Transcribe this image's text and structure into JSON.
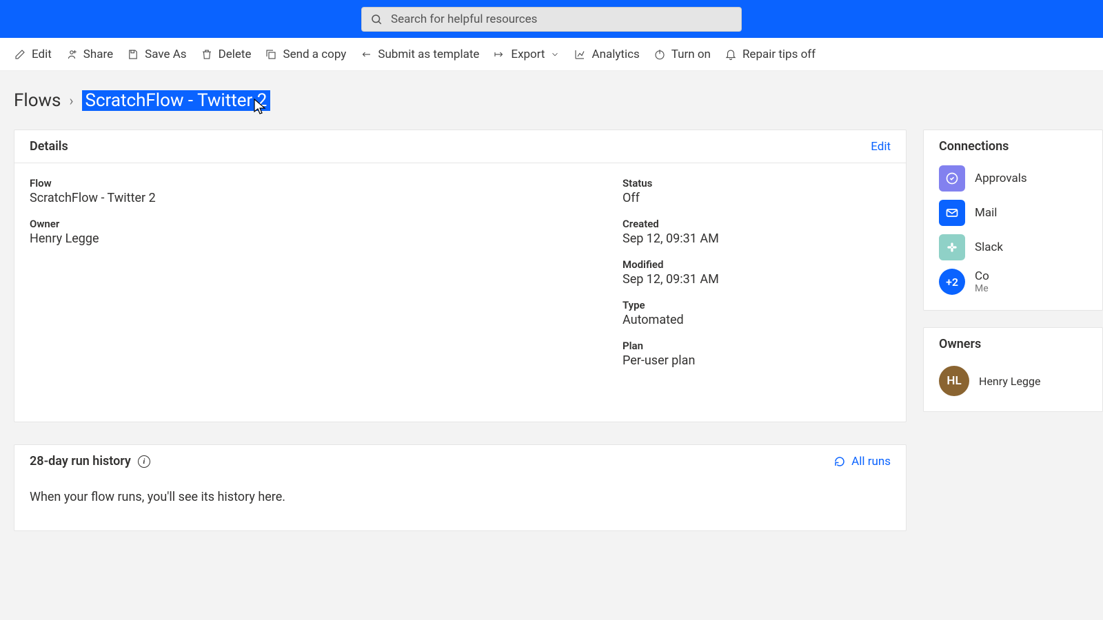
{
  "search": {
    "placeholder": "Search for helpful resources"
  },
  "toolbar": {
    "edit": "Edit",
    "share": "Share",
    "saveas": "Save As",
    "delete": "Delete",
    "sendcopy": "Send a copy",
    "submit": "Submit as template",
    "export": "Export",
    "analytics": "Analytics",
    "turnon": "Turn on",
    "repair": "Repair tips off"
  },
  "breadcrumb": {
    "root": "Flows",
    "current": "ScratchFlow - Twitter 2"
  },
  "details": {
    "header": "Details",
    "edit": "Edit",
    "flow_label": "Flow",
    "flow_value": "ScratchFlow - Twitter 2",
    "owner_label": "Owner",
    "owner_value": "Henry Legge",
    "status_label": "Status",
    "status_value": "Off",
    "created_label": "Created",
    "created_value": "Sep 12, 09:31 AM",
    "modified_label": "Modified",
    "modified_value": "Sep 12, 09:31 AM",
    "type_label": "Type",
    "type_value": "Automated",
    "plan_label": "Plan",
    "plan_value": "Per-user plan"
  },
  "history": {
    "title": "28-day run history",
    "allruns": "All runs",
    "empty": "When your flow runs, you'll see its history here."
  },
  "connections": {
    "title": "Connections",
    "items": [
      {
        "label": "Approvals",
        "color": "#8281ef"
      },
      {
        "label": "Mail",
        "color": "#0a63ff"
      },
      {
        "label": "Slack",
        "color": "#8fd1c7"
      }
    ],
    "more_badge": "+2",
    "more_label": "Co",
    "more_sub": "Me"
  },
  "owners": {
    "title": "Owners",
    "initials": "HL",
    "name": "Henry Legge"
  }
}
